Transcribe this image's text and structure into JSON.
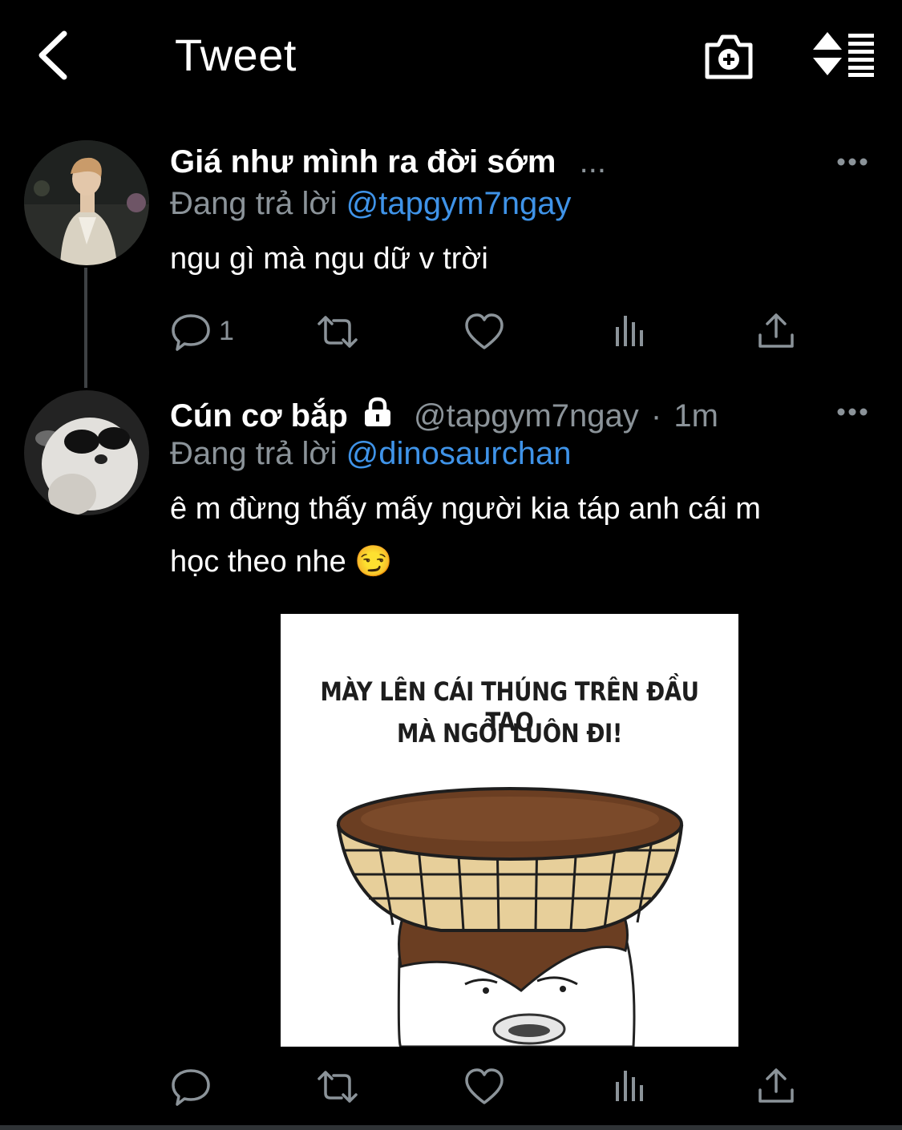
{
  "header": {
    "title": "Tweet",
    "back_icon": "chevron-left-icon",
    "camera_icon": "camera-plus-icon",
    "sort_icon": "sort-list-icon"
  },
  "tweets": [
    {
      "display_name": "Giá như mình ra đời sớm",
      "truncation": "...",
      "replying_prefix": "Đang trả lời",
      "replying_to": "@tapgym7ngay",
      "text": "ngu gì mà ngu dữ v trời",
      "reply_count": "1"
    },
    {
      "display_name": "Cún cơ bắp",
      "handle": "@tapgym7ngay",
      "separator": "·",
      "time": "1m",
      "replying_prefix": "Đang trả lời",
      "replying_to": "@dinosaurchan",
      "text_line1": "ê m đừng thấy mấy người kia táp anh cái m",
      "text_line2": "học theo nhe 😏",
      "meme_line1": "MÀY LÊN CÁI THÚNG TRÊN ĐẦU TAO",
      "meme_line2": "MÀ NGỒI LUÔN ĐI!"
    }
  ],
  "colors": {
    "background": "#000000",
    "secondary_text": "#8b9399",
    "link": "#3f93e8",
    "thread_line": "#3e4144"
  }
}
